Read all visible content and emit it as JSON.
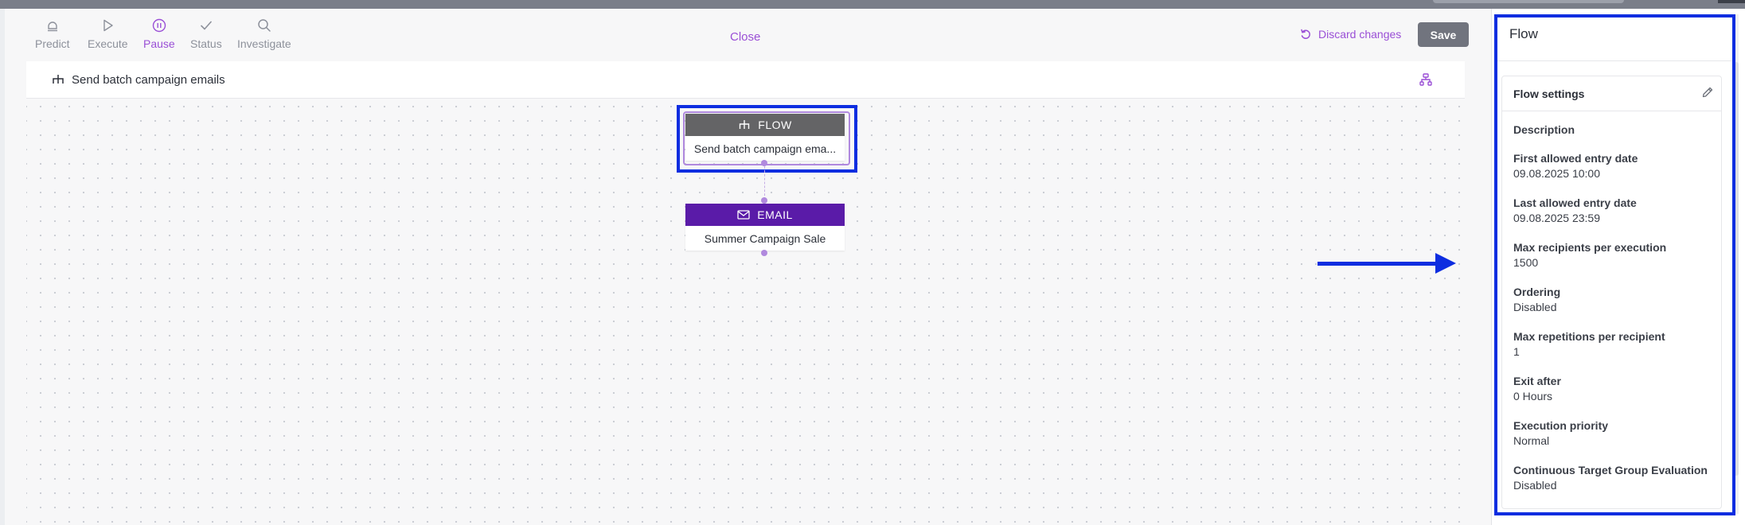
{
  "toolbar": {
    "tools": [
      {
        "label": "Predict",
        "icon": "lightbulb-icon"
      },
      {
        "label": "Execute",
        "icon": "play-icon"
      },
      {
        "label": "Pause",
        "icon": "pause-icon",
        "active": true
      },
      {
        "label": "Status",
        "icon": "check-icon"
      },
      {
        "label": "Investigate",
        "icon": "search-icon"
      }
    ],
    "close_label": "Close",
    "discard_label": "Discard changes",
    "save_label": "Save"
  },
  "canvas": {
    "title": "Send batch campaign emails",
    "nodes": [
      {
        "type_label": "FLOW",
        "name": "Send batch campaign ema...",
        "icon": "flow-icon",
        "color": "#646466"
      },
      {
        "type_label": "EMAIL",
        "name": "Summer Campaign Sale",
        "icon": "envelope-icon",
        "color": "#5a1ba8"
      }
    ]
  },
  "panel": {
    "title": "Flow",
    "settings_title": "Flow settings",
    "fields": [
      {
        "label": "Description",
        "value": ""
      },
      {
        "label": "First allowed entry date",
        "value": "09.08.2025 10:00"
      },
      {
        "label": "Last allowed entry date",
        "value": "09.08.2025 23:59"
      },
      {
        "label": "Max recipients per execution",
        "value": "1500"
      },
      {
        "label": "Ordering",
        "value": "Disabled"
      },
      {
        "label": "Max repetitions per recipient",
        "value": "1"
      },
      {
        "label": "Exit after",
        "value": "0 Hours"
      },
      {
        "label": "Execution priority",
        "value": "Normal"
      },
      {
        "label": "Continuous Target Group Evaluation",
        "value": "Disabled"
      }
    ]
  },
  "colors": {
    "accent": "#9a4fd6",
    "highlight": "#0d2de0",
    "save_button": "#71747e"
  }
}
